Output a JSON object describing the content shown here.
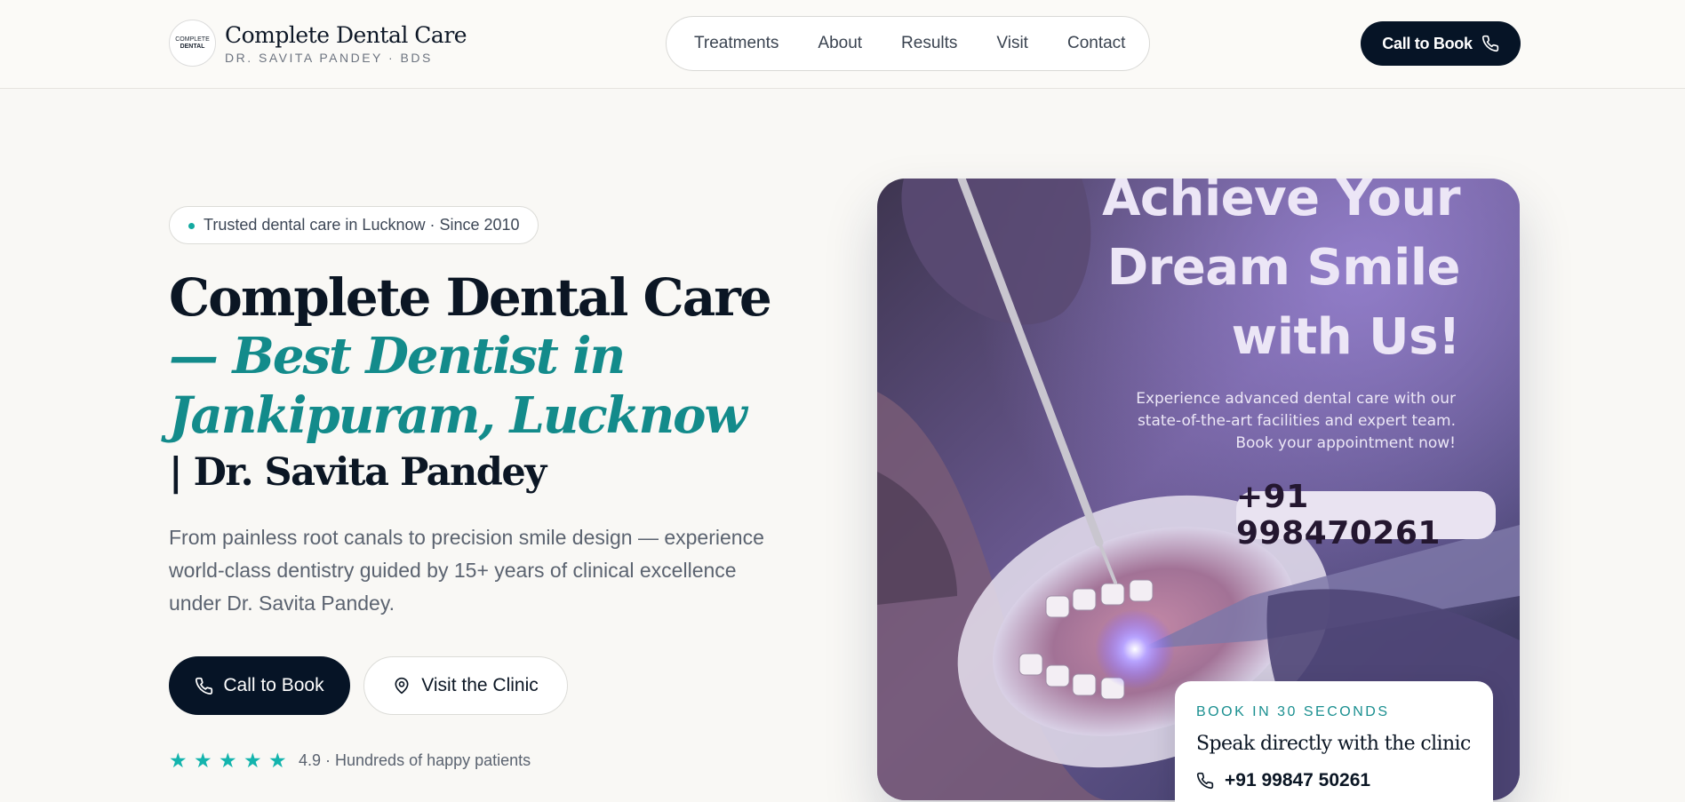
{
  "header": {
    "logo": {
      "line1": "COMPLETE",
      "line2": "DENTAL"
    },
    "brand_title": "Complete Dental Care",
    "brand_subtitle": "DR. SAVITA PANDEY · BDS",
    "nav": [
      "Treatments",
      "About",
      "Results",
      "Visit",
      "Contact"
    ],
    "cta_label": "Call to Book"
  },
  "hero": {
    "badge": "Trusted dental care in Lucknow · Since 2010",
    "heading_line1": "Complete Dental Care",
    "heading_line2a": "— Best Dentist in",
    "heading_line2b": "Jankipuram, Lucknow",
    "heading_line3": "| Dr. Savita Pandey",
    "lead_line1": "From painless root canals to precision smile design — experience",
    "lead_line2": "world-class dentistry guided by 15+ years of clinical excellence",
    "lead_line3": "under Dr. Savita Pandey.",
    "primary_button": "Call to Book",
    "secondary_button": "Visit the Clinic",
    "rating": {
      "stars": 5,
      "text": "4.9 · Hundreds of happy patients"
    }
  },
  "promo": {
    "title_line1": "Achieve Your",
    "title_line2": "Dream Smile",
    "title_line3": "with Us!",
    "text_line1": "Experience advanced dental care with our",
    "text_line2": "state-of-the-art facilities and expert team.",
    "text_line3": "Book your appointment now!",
    "phone": "+91 998470261"
  },
  "book_card": {
    "eyebrow": "BOOK IN 30 SECONDS",
    "title": "Speak directly with the clinic",
    "phone": "+91 99847 50261"
  },
  "colors": {
    "accent": "#138b8b",
    "dark": "#061426",
    "star": "#14b4ad"
  }
}
